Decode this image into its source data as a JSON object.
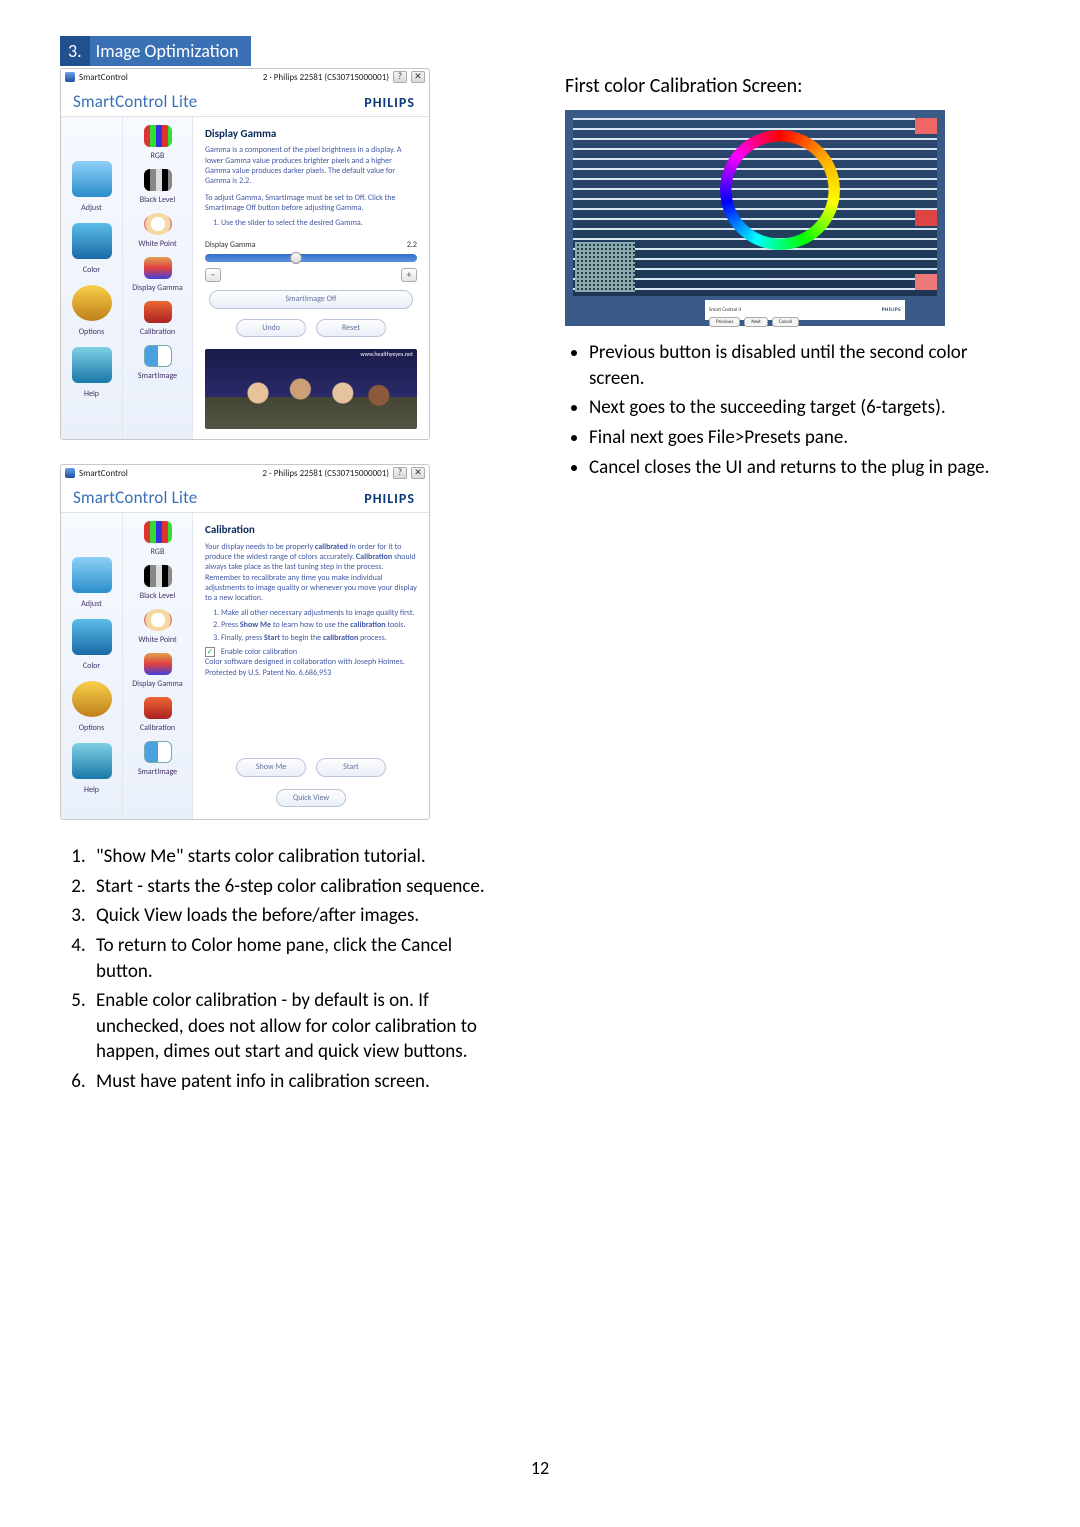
{
  "header": {
    "num": "3.",
    "title": "Image Optimization"
  },
  "page_number": "12",
  "sc_common": {
    "app_name": "SmartControl",
    "title_text": "SmartControl Lite",
    "brand": "PHILIPS",
    "window_meta1": "2 · Philips 22581 (CS30715000001)",
    "window_meta2": "2 - Philips 22581 (CS30715000001)",
    "help_char": "?",
    "close_char": "✕"
  },
  "nav_main": {
    "adjust": "Adjust",
    "color": "Color",
    "options": "Options",
    "help": "Help"
  },
  "nav_sub": {
    "rgb": "RGB",
    "black": "Black Level",
    "white": "White Point",
    "gamma": "Display Gamma",
    "calib": "Calibration",
    "smartimg": "SmartImage"
  },
  "win_gamma": {
    "heading": "Display Gamma",
    "para1": "Gamma is a component of the pixel brightness in a display. A lower Gamma value produces brighter pixels and a higher Gamma value produces darker pixels. The default value for Gamma is 2.2.",
    "para2": "To adjust Gamma, SmartImage must be set to Off. Click the SmartImage Off button before adjusting Gamma.",
    "instr1": "Use the slider to select the desired Gamma.",
    "slider_label": "Display Gamma",
    "slider_value": "2.2",
    "minus": "−",
    "plus": "+",
    "btn_smartimage_off": "SmartImage Off",
    "btn_undo": "Undo",
    "btn_reset": "Reset",
    "photo_caption": "www.healthyeyes.net"
  },
  "win_calib": {
    "heading": "Calibration",
    "para1_a": "Your display needs to be properly ",
    "para1_b": "calibrated",
    "para1_c": " in order for it to produce the widest range of colors accurately. ",
    "para1_d": "Calibration",
    "para1_e": " should always take place as the last tuning step in the process. Remember to recalibrate any time you make individual adjustments to image quality or whenever you move your display to a new location.",
    "li1": "Make all other necessary adjustments to image quality first.",
    "li2_a": "Press ",
    "li2_b": "Show Me",
    "li2_c": " to learn how to use the ",
    "li2_d": "calibration",
    "li2_e": " tools.",
    "li3_a": "Finally, press ",
    "li3_b": "Start",
    "li3_c": " to begin the ",
    "li3_d": "calibration",
    "li3_e": " process.",
    "enable_label": "Enable color calibration",
    "credit_line": "Color software designed in collaboration with Joseph Holmes.",
    "patent_line": "Protected by U.S. Patent No. 6,686,953",
    "btn_show_me": "Show Me",
    "btn_start": "Start",
    "btn_quick_view": "Quick View"
  },
  "calib_preview": {
    "label": "Smart Control II",
    "brand": "PHILIPS",
    "btn_prev": "Previous",
    "btn_next": "Next",
    "btn_cancel": "Cancel"
  },
  "left_steps": {
    "s1": "\"Show Me\" starts color calibration tutorial.",
    "s2": "Start - starts the 6-step color calibration sequence.",
    "s3": "Quick View loads the before/after images.",
    "s4": "To return to Color home pane, click the Cancel button.",
    "s5": "Enable color calibration - by default is on. If unchecked, does not allow for color calibration to happen, dimes out start and quick view buttons.",
    "s6": "Must have patent info in calibration screen."
  },
  "right_col": {
    "heading": "First color Calibration Screen:",
    "b1": "Previous button is disabled until the second color screen.",
    "b2": "Next goes to the succeeding target (6-targets).",
    "b3": "Final next goes File>Presets pane.",
    "b4": "Cancel closes the UI and returns to the plug in page."
  }
}
